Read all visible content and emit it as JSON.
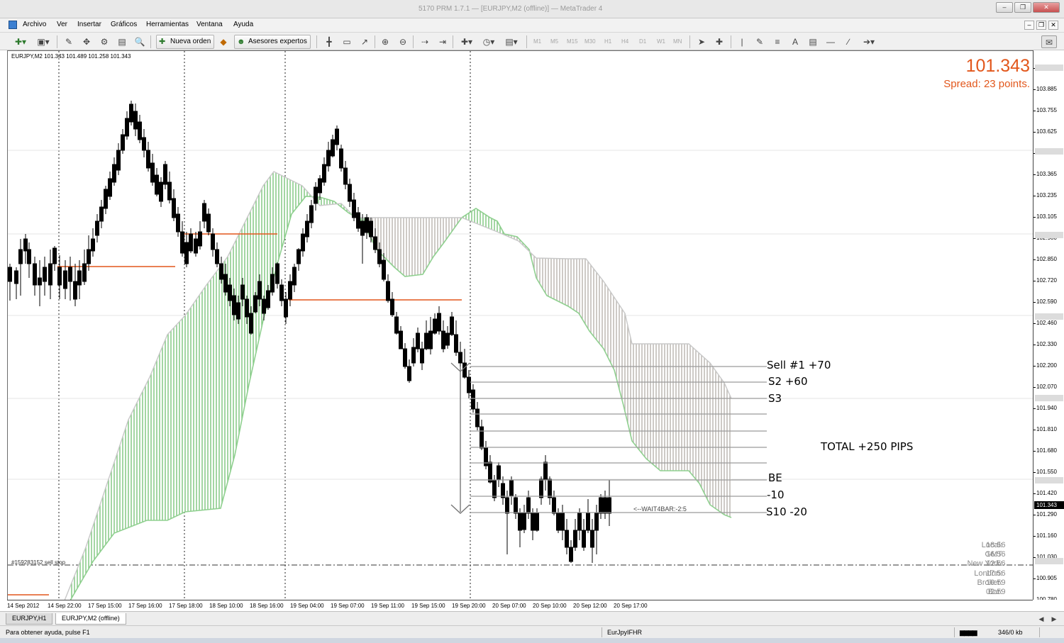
{
  "window": {
    "title": "5170 PRM 1.7.1 — [EURJPY,M2 (offline)] — MetaTrader 4"
  },
  "menu": [
    "Archivo",
    "Ver",
    "Insertar",
    "Gráficos",
    "Herramientas",
    "Ventana",
    "Ayuda"
  ],
  "toolbar": {
    "new_order": "Nueva orden",
    "expert_advisors": "Asesores expertos",
    "timeframes": [
      "M1",
      "M5",
      "M15",
      "M30",
      "H1",
      "H4",
      "D1",
      "W1",
      "MN"
    ]
  },
  "chart": {
    "header": "EURJPY,M2  101.343 101.489 101.258 101.343",
    "bid": "101.343",
    "spread_text": "Spread: 23 points.",
    "annotations": {
      "sell1": "Sell #1 +70",
      "s2": "S2 +60",
      "s3": "S3",
      "total": "TOTAL +250 PIPS",
      "be": "BE",
      "minus10": "-10",
      "s10": "S10 -20",
      "waitbar": "<--WAIT4BAR:-2:5"
    },
    "stop_label": "#159283152 sell stop",
    "clock": {
      "labels": [
        "Local:",
        "GMT",
        "New York:",
        "London:",
        "Broker:",
        "Bar:"
      ],
      "values": [
        "18:56",
        "16:56",
        "12:56",
        "17:56",
        "19:59",
        "02:59"
      ]
    }
  },
  "price_axis": {
    "ticks": [
      "104.015",
      "103.885",
      "103.755",
      "103.625",
      "103.495",
      "103.365",
      "103.235",
      "103.105",
      "102.980",
      "102.850",
      "102.720",
      "102.590",
      "102.460",
      "102.330",
      "102.200",
      "102.070",
      "101.940",
      "101.810",
      "101.680",
      "101.550",
      "101.420",
      "101.290",
      "101.160",
      "101.030",
      "100.905",
      "100.780"
    ],
    "current": "101.343"
  },
  "time_axis": {
    "ticks": [
      "14 Sep 2012",
      "14 Sep 22:00",
      "17 Sep 15:00",
      "17 Sep 16:00",
      "17 Sep 18:00",
      "18 Sep 10:00",
      "18 Sep 16:00",
      "19 Sep 04:00",
      "19 Sep 07:00",
      "19 Sep 11:00",
      "19 Sep 15:00",
      "19 Sep 20:00",
      "20 Sep 07:00",
      "20 Sep 10:00",
      "20 Sep 12:00",
      "20 Sep 17:00"
    ]
  },
  "tabs": [
    "EURJPY,H1",
    "EURJPY,M2 (offline)"
  ],
  "status": {
    "help": "Para obtener ayuda, pulse F1",
    "profile": "EurJpyIFHR",
    "traffic": "346/0 kb"
  },
  "colors": {
    "bid": "#e2571c",
    "bull_cloud": "#7cc47c",
    "bear_cloud": "#b8b4ae",
    "level_line": "#9a9a9a",
    "orange_line": "#e2571c"
  },
  "chart_data": {
    "type": "candlestick",
    "symbol": "EURJPY",
    "timeframe": "M2",
    "ohlc_last": {
      "open": 101.343,
      "high": 101.489,
      "low": 101.258,
      "close": 101.343
    },
    "levels": [
      {
        "label": "Sell #1 +70",
        "price": 102.19
      },
      {
        "label": "S2 +60",
        "price": 102.1
      },
      {
        "label": "S3",
        "price": 102.0
      },
      {
        "label": "BE",
        "price": 101.55
      },
      {
        "label": "-10",
        "price": 101.45
      },
      {
        "label": "S10 -20",
        "price": 101.35
      }
    ],
    "ylim": [
      100.78,
      104.05
    ]
  }
}
